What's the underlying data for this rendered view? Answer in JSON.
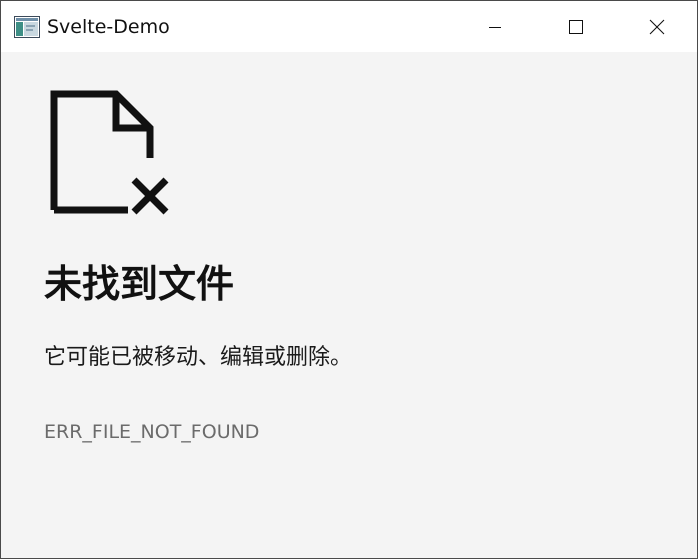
{
  "window": {
    "title": "Svelte-Demo",
    "controls": {
      "minimize_icon": "minimize-icon",
      "maximize_icon": "maximize-icon",
      "close_icon": "close-icon"
    }
  },
  "error_page": {
    "icon": "file-not-found-icon",
    "heading": "未找到文件",
    "message": "它可能已被移动、编辑或删除。",
    "code": "ERR_FILE_NOT_FOUND"
  },
  "colors": {
    "background": "#f4f4f4",
    "titlebar": "#ffffff",
    "text": "#111111",
    "code_text": "#6b6b6b"
  }
}
